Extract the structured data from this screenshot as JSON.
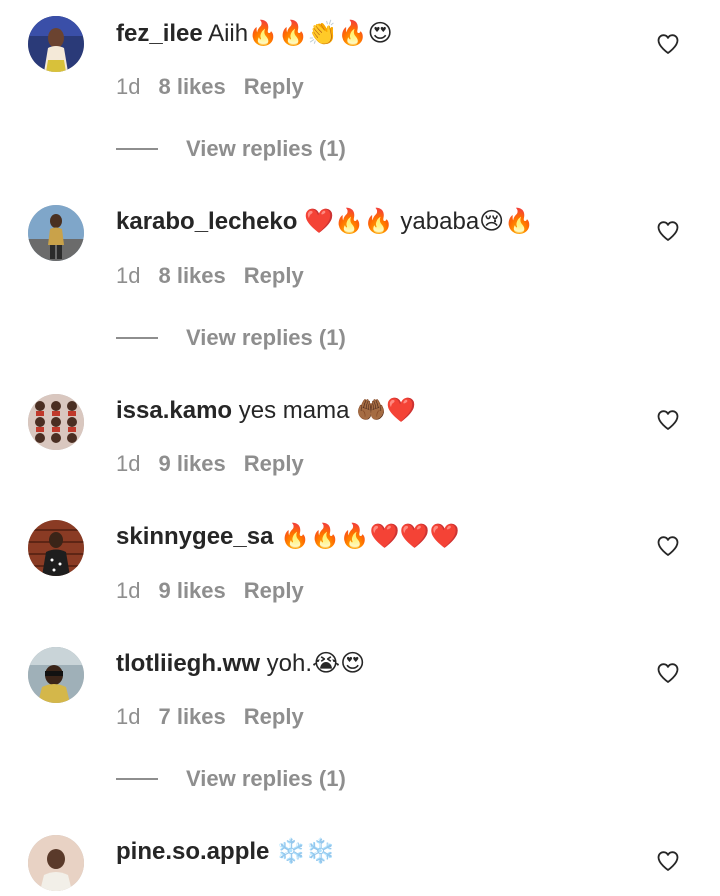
{
  "comments": [
    {
      "username": "fez_ilee",
      "text": "Aiih🔥🔥👏🔥😍",
      "time": "1d",
      "likes": "8 likes",
      "reply": "Reply",
      "view_replies": "View replies (1)"
    },
    {
      "username": "karabo_lecheko",
      "text": "❤️🔥🔥 yababa😢🔥",
      "time": "1d",
      "likes": "8 likes",
      "reply": "Reply",
      "view_replies": "View replies (1)"
    },
    {
      "username": "issa.kamo",
      "text": "yes mama 🤲🏾❤️",
      "time": "1d",
      "likes": "9 likes",
      "reply": "Reply"
    },
    {
      "username": "skinnygee_sa",
      "text": "🔥🔥🔥❤️❤️❤️",
      "time": "1d",
      "likes": "9 likes",
      "reply": "Reply"
    },
    {
      "username": "tlotliiegh.ww",
      "text": "yoh.😭😍",
      "time": "1d",
      "likes": "7 likes",
      "reply": "Reply",
      "view_replies": "View replies (1)"
    },
    {
      "username": "pine.so.apple",
      "text": "❄️❄️"
    }
  ],
  "colors": {
    "primary_text": "#262626",
    "secondary_text": "#8e8e8e",
    "background": "#ffffff"
  },
  "icons": {
    "like": "heart-outline-icon"
  }
}
